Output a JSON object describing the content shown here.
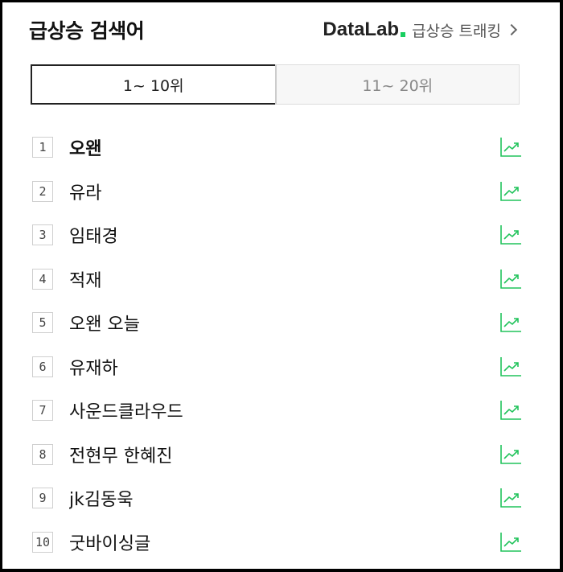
{
  "header": {
    "title": "급상승 검색어",
    "brand": "DataLab",
    "subtitle": "급상승 트래킹"
  },
  "tabs": [
    {
      "label": "1~ 10위",
      "active": true
    },
    {
      "label": "11~ 20위",
      "active": false
    }
  ],
  "ranking": [
    {
      "rank": "1",
      "keyword": "오왠",
      "bold": true
    },
    {
      "rank": "2",
      "keyword": "유라",
      "bold": false
    },
    {
      "rank": "3",
      "keyword": "임태경",
      "bold": false
    },
    {
      "rank": "4",
      "keyword": "적재",
      "bold": false
    },
    {
      "rank": "5",
      "keyword": "오왠 오늘",
      "bold": false
    },
    {
      "rank": "6",
      "keyword": "유재하",
      "bold": false
    },
    {
      "rank": "7",
      "keyword": "사운드클라우드",
      "bold": false
    },
    {
      "rank": "8",
      "keyword": "전현무 한혜진",
      "bold": false
    },
    {
      "rank": "9",
      "keyword": "jk김동욱",
      "bold": false
    },
    {
      "rank": "10",
      "keyword": "굿바이싱글",
      "bold": false
    }
  ],
  "colors": {
    "brand_green": "#19ce60",
    "trend_green": "#21c35b"
  },
  "icons": {
    "trend": "trend-chart-icon",
    "chevron": "chevron-right-icon"
  }
}
